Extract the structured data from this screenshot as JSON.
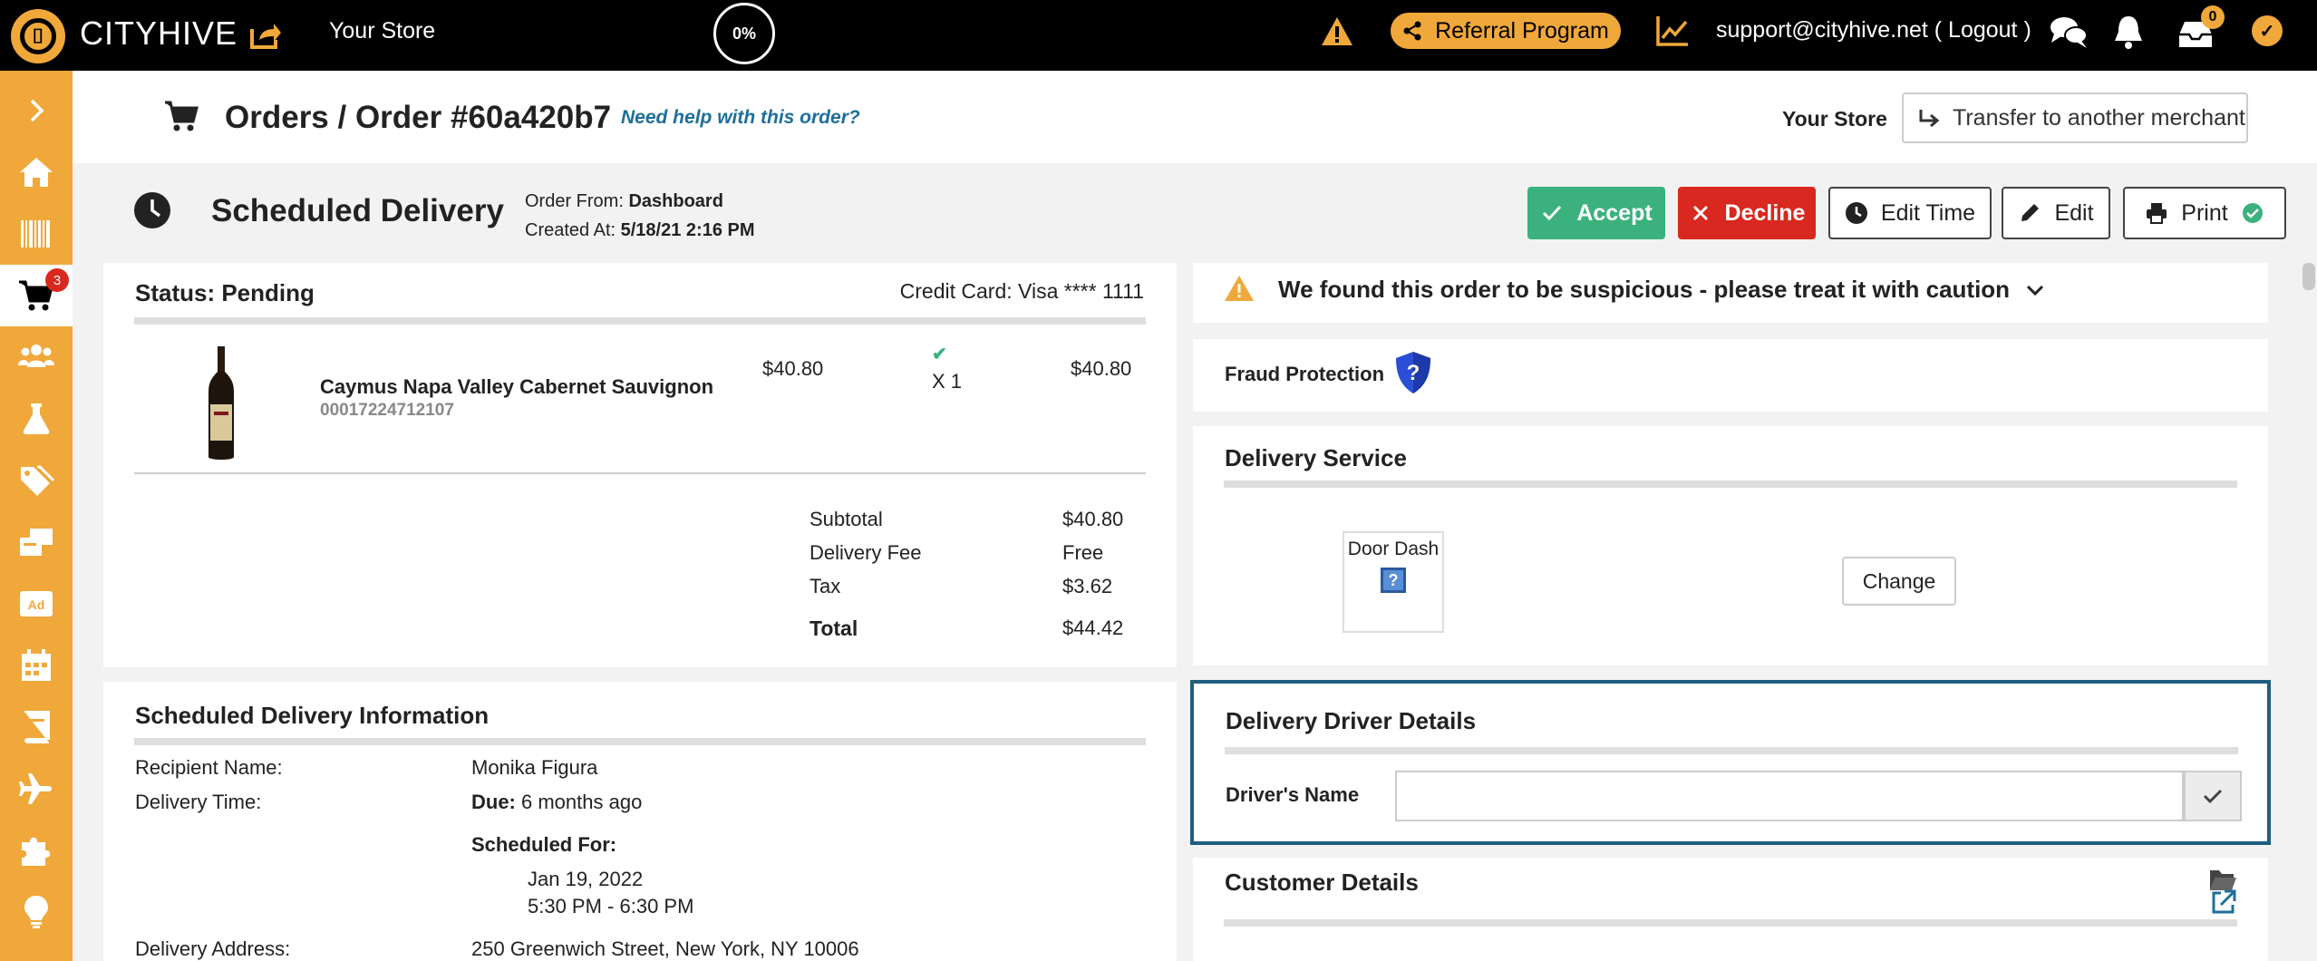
{
  "topbar": {
    "brand": "CITYHIVE",
    "store": "Your Store",
    "progress": "0%",
    "referral_label": "Referral Program",
    "support_text": "support@cityhive.net ( Logout )",
    "inbox_count": "0"
  },
  "sidebar": {
    "cart_badge": "3",
    "items": [
      "expand",
      "home",
      "barcode",
      "orders",
      "customers",
      "lab",
      "tags",
      "products",
      "ads",
      "calendar",
      "book",
      "travel",
      "integrations",
      "ideas"
    ]
  },
  "header": {
    "breadcrumb": "Orders / Order #60a420b7",
    "help_link": "Need help with this order?",
    "store": "Your Store",
    "transfer_label": "Transfer to another merchant"
  },
  "title_row": {
    "title": "Scheduled Delivery",
    "order_from_label": "Order From: ",
    "order_from_value": "Dashboard",
    "created_at_label": "Created At: ",
    "created_at_value": "5/18/21 2:16 PM",
    "accept": "Accept",
    "decline": "Decline",
    "edit_time": "Edit Time",
    "edit": "Edit",
    "print": "Print"
  },
  "order": {
    "status": "Status: Pending",
    "credit_card": "Credit Card: Visa **** 1111",
    "item": {
      "name": "Caymus Napa Valley Cabernet Sauvignon",
      "sku": "00017224712107",
      "price": "$40.80",
      "qty": "X 1",
      "total": "$40.80"
    },
    "summary": [
      {
        "label": "Subtotal",
        "value": "$40.80"
      },
      {
        "label": "Delivery Fee",
        "value": "Free"
      },
      {
        "label": "Tax",
        "value": "$3.62"
      },
      {
        "label": "Total",
        "value": "$44.42"
      }
    ]
  },
  "scheduled_info": {
    "title": "Scheduled Delivery Information",
    "recipient_label": "Recipient Name:",
    "recipient_value": "Monika Figura",
    "time_label": "Delivery Time:",
    "due_label": "Due:",
    "due_value": " 6 months ago",
    "scheduled_for_label": "Scheduled For:",
    "scheduled_date": "Jan 19, 2022",
    "scheduled_window": "5:30 PM - 6:30 PM",
    "address_label": "Delivery Address:",
    "address_value": "250 Greenwich Street, New York, NY 10006"
  },
  "right": {
    "warning": "We found this order to be suspicious - please treat it with caution",
    "fraud_label": "Fraud Protection",
    "delivery_service_title": "Delivery Service",
    "provider": "Door Dash",
    "provider_icon": "?",
    "change": "Change",
    "driver_title": "Delivery Driver Details",
    "driver_label": "Driver's Name",
    "driver_value": "",
    "customer_title": "Customer Details"
  },
  "colors": {
    "accent": "#f0a83a",
    "accept": "#3bb27d",
    "decline": "#d9281f",
    "link": "#1e6f9b",
    "highlight_border": "#1e5f80"
  }
}
